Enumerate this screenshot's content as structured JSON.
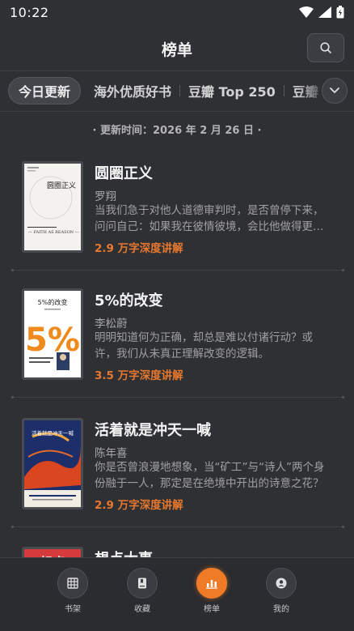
{
  "status_bar": {
    "time": "10:22"
  },
  "header": {
    "title": "榜单"
  },
  "tabs": [
    {
      "label": "今日更新",
      "active": true
    },
    {
      "label": "海外优质好书",
      "active": false
    },
    {
      "label": "豆瓣 Top 250",
      "active": false
    },
    {
      "label": "豆瓣",
      "active": false
    }
  ],
  "update_time": "· 更新时间：2026 年 2 月 26 日 ·",
  "books": [
    {
      "title": "圆圈正义",
      "author": "罗翔",
      "description": "当我们急于对他人道德审判时，是否曾停下来，问问自己：如果我在彼情彼境，会比他做得更…",
      "badge": "2.9 万字深度讲解",
      "cover": {
        "title": "圆圈正义",
        "subtitle": "— FAITH AS REASON —"
      }
    },
    {
      "title": "5%的改变",
      "author": "李松蔚",
      "description": "明明知道何为正确，却总是难以付诸行动？或许，我们从未真正理解改变的逻辑。",
      "badge": "3.5 万字深度讲解",
      "cover": {
        "title": "5%的改变",
        "big": "5%"
      }
    },
    {
      "title": "活着就是冲天一喊",
      "author": "陈年喜",
      "description": "你是否曾浪漫地想象，当“矿工”与“诗人”两个身份融于一人，那定是在绝境中开出的诗意之花？",
      "badge": "2.9 万字深度讲解",
      "cover": {
        "title": "活着就是冲天一喊"
      }
    },
    {
      "title": "想点大事",
      "author": "",
      "description": "",
      "badge": "",
      "cover": {
        "title": "想点"
      }
    }
  ],
  "bottom_nav": [
    {
      "label": "书架",
      "icon": "bookshelf-icon",
      "active": false
    },
    {
      "label": "收藏",
      "icon": "bookmark-icon",
      "active": false
    },
    {
      "label": "榜单",
      "icon": "chart-icon",
      "active": true
    },
    {
      "label": "我的",
      "icon": "profile-icon",
      "active": false
    }
  ],
  "colors": {
    "accent": "#f07b26",
    "badge": "#e8782e",
    "background": "#2f3034"
  }
}
